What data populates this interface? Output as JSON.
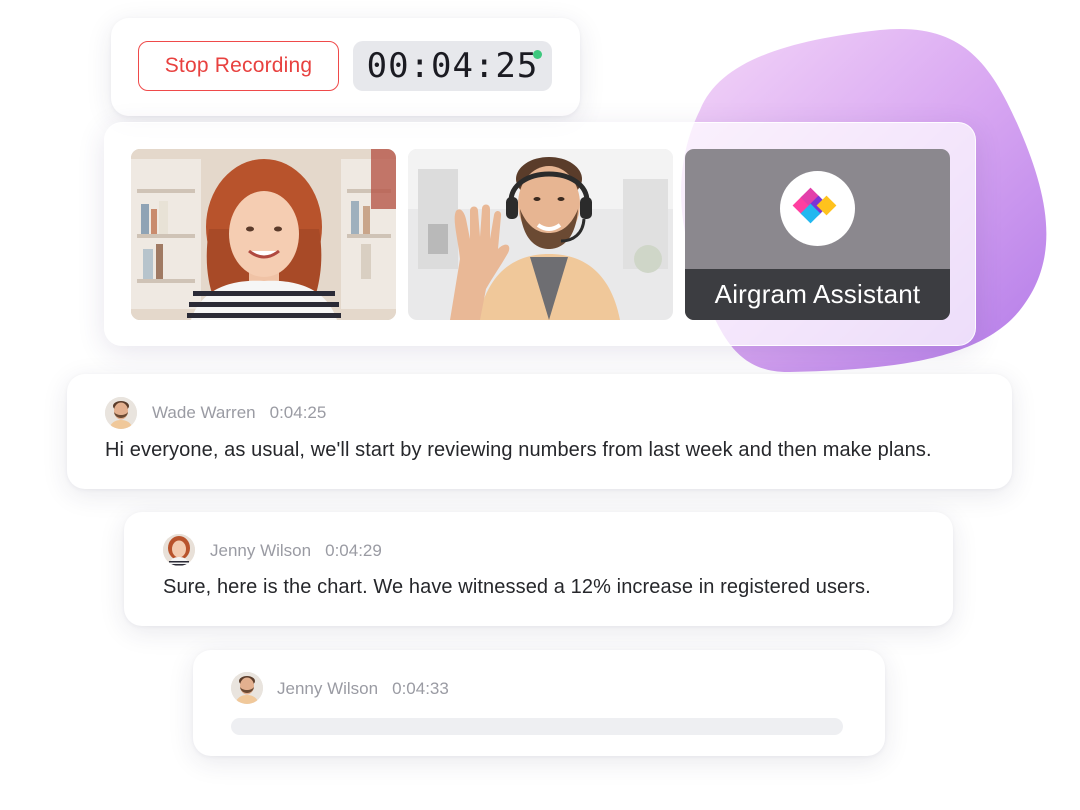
{
  "recording": {
    "stop_label": "Stop Recording",
    "timer": "00:04:25",
    "status_color": "#3ec87e",
    "accent_color": "#e8413f"
  },
  "participants": [
    {
      "icon": "participant-woman-video"
    },
    {
      "icon": "participant-man-video"
    },
    {
      "label": "Airgram Assistant",
      "icon": "airgram-logo-icon"
    }
  ],
  "transcript": [
    {
      "speaker": "Wade Warren",
      "time": "0:04:25",
      "text": "Hi everyone, as usual, we'll start by reviewing numbers from last week and then make plans."
    },
    {
      "speaker": "Jenny Wilson",
      "time": "0:04:29",
      "text": "Sure, here is the chart. We have witnessed a 12% increase in registered users."
    },
    {
      "speaker": "Jenny Wilson",
      "time": "0:04:33",
      "text": ""
    }
  ]
}
